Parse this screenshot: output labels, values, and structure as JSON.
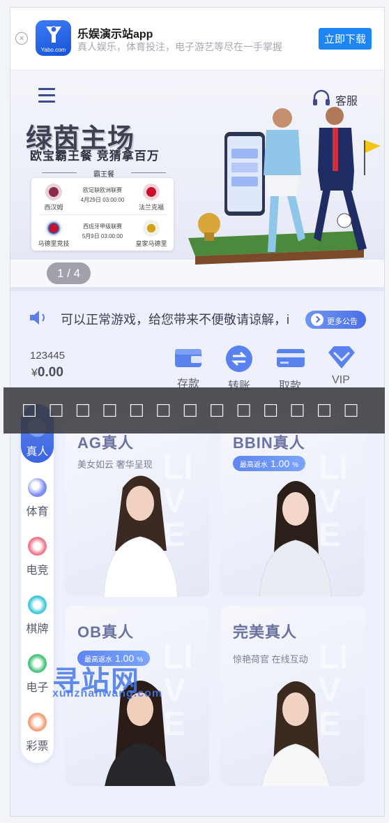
{
  "download_bar": {
    "close_icon": "close-circle-icon",
    "logo_text": "Yabo.com",
    "app_name": "乐娱演示站app",
    "slogan": "真人娱乐，体育投注，电子游艺等尽在一手掌握",
    "download_label": "立即下载"
  },
  "header": {
    "menu_icon": "hamburger-menu-icon",
    "customer_service_icon": "headset-icon",
    "customer_service_label": "客服"
  },
  "banner": {
    "title": "绿茵主场",
    "subtitle": "欧宝霸王餐 竞猜拿百万",
    "match_header": "霸王餐",
    "matches": [
      {
        "home": "西汉姆",
        "away": "法兰克福",
        "league": "欧足联欧洲联赛",
        "time": "4月29日  03:00:00"
      },
      {
        "home": "马德里竞技",
        "away": "皇家马德里",
        "league": "西班牙甲级联赛",
        "time": "5月9日  03:00:00"
      }
    ],
    "pager": "1 / 4"
  },
  "notice": {
    "speaker_icon": "speaker-icon",
    "text": "可以正常游戏，给您带来不便敬请谅解，i",
    "more_label": "更多公告"
  },
  "wallet": {
    "account": "123445",
    "currency": "¥",
    "balance": "0.00",
    "actions": [
      {
        "label": "存款",
        "icon": "wallet-icon"
      },
      {
        "label": "转账",
        "icon": "transfer-icon"
      },
      {
        "label": "取款",
        "icon": "card-icon"
      },
      {
        "label": "VIP",
        "icon": "diamond-icon"
      }
    ]
  },
  "overlay": {
    "text": "□ □ □ □ □ □ □ □ □ □ □ □ □"
  },
  "categories": [
    {
      "label": "真人",
      "icon": "live-casino-icon",
      "active": true
    },
    {
      "label": "体育",
      "icon": "sports-icon",
      "active": false
    },
    {
      "label": "电竞",
      "icon": "esports-icon",
      "active": false
    },
    {
      "label": "棋牌",
      "icon": "cards-icon",
      "active": false
    },
    {
      "label": "电子",
      "icon": "slots-icon",
      "active": false
    },
    {
      "label": "彩票",
      "icon": "lottery-icon",
      "active": false
    }
  ],
  "games": [
    {
      "title": "AG真人",
      "tagline": "美女如云 奢华呈现",
      "rebate_label": "",
      "rebate_value": "",
      "rebate_unit": ""
    },
    {
      "title": "BBIN真人",
      "tagline": "",
      "rebate_label": "最高返水",
      "rebate_value": "1.00",
      "rebate_unit": "%"
    },
    {
      "title": "OB真人",
      "tagline": "",
      "rebate_label": "最高返水",
      "rebate_value": "1.00",
      "rebate_unit": "%"
    },
    {
      "title": "完美真人",
      "tagline": "惊艳荷官 在线互动",
      "rebate_label": "",
      "rebate_value": "",
      "rebate_unit": ""
    }
  ],
  "site_watermark": {
    "big": "寻站网",
    "small": "xunzhanwang.com"
  },
  "colors": {
    "primary": "#1e86f4",
    "accent_blue": "#4c6fe6",
    "page_bg": "#eef1fb"
  }
}
